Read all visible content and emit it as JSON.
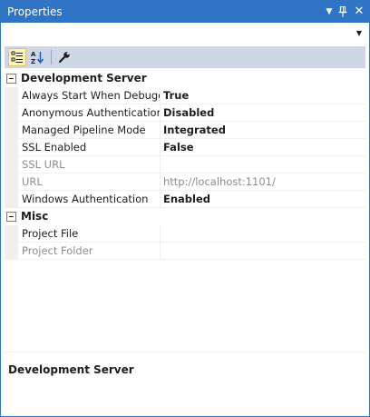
{
  "window": {
    "title": "Properties",
    "icons": {
      "dropdown": "triangle-down-icon",
      "pin": "pin-icon",
      "close": "close-icon"
    }
  },
  "object_selector": {
    "value": "",
    "icon": "chevron-down-icon"
  },
  "toolbar": {
    "categorized": {
      "icon": "categorized-icon",
      "active": true
    },
    "alphabetical": {
      "icon": "sort-az-icon",
      "active": false
    },
    "property_pages": {
      "icon": "wrench-icon",
      "active": false
    }
  },
  "categories": [
    {
      "name": "Development Server",
      "expanded": true,
      "properties": [
        {
          "name": "Always Start When Debugging",
          "value": "True",
          "bold": true,
          "readonly": false
        },
        {
          "name": "Anonymous Authentication",
          "value": "Disabled",
          "bold": true,
          "readonly": false
        },
        {
          "name": "Managed Pipeline Mode",
          "value": "Integrated",
          "bold": true,
          "readonly": false
        },
        {
          "name": "SSL Enabled",
          "value": "False",
          "bold": true,
          "readonly": false
        },
        {
          "name": "SSL URL",
          "value": "",
          "bold": false,
          "readonly": true
        },
        {
          "name": "URL",
          "value": "http://localhost:1101/",
          "bold": false,
          "readonly": true
        },
        {
          "name": "Windows Authentication",
          "value": "Enabled",
          "bold": true,
          "readonly": false
        }
      ]
    },
    {
      "name": "Misc",
      "expanded": true,
      "properties": [
        {
          "name": "Project File",
          "value": "",
          "bold": false,
          "readonly": false
        },
        {
          "name": "Project Folder",
          "value": "",
          "bold": false,
          "readonly": true
        }
      ]
    }
  ],
  "description": {
    "title": "Development Server"
  },
  "colors": {
    "accent": "#2f74c5",
    "toolbar": "#cfd6e5",
    "gutter": "#f0f0f0",
    "readonly_text": "#8d8d8d"
  }
}
